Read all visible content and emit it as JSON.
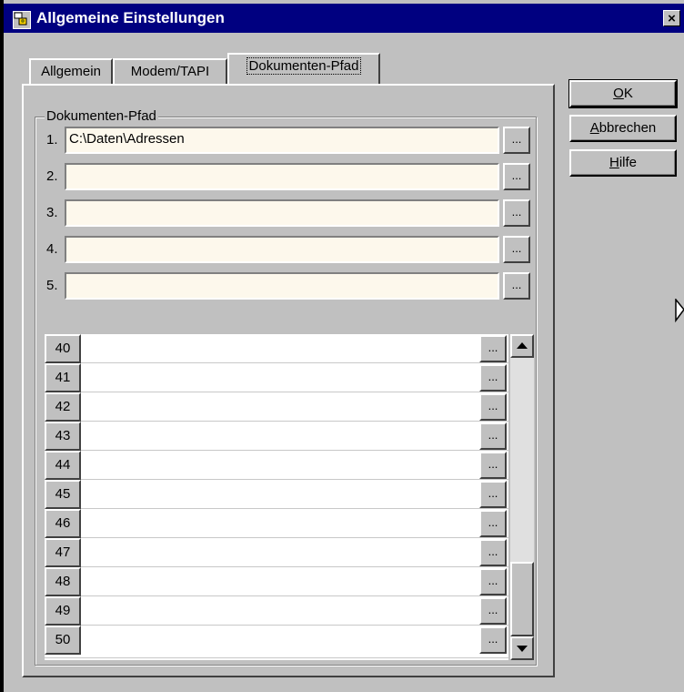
{
  "window": {
    "title": "Allgemeine Einstellungen",
    "close_label": "×"
  },
  "tabs": [
    {
      "label": "Allgemein",
      "active": false
    },
    {
      "label": "Modem/TAPI",
      "active": false
    },
    {
      "label": "Dokumenten-Pfad",
      "active": true
    }
  ],
  "group": {
    "label": "Dokumenten-Pfad"
  },
  "paths": [
    {
      "num": "1.",
      "value": "C:\\Daten\\Adressen",
      "button": "..."
    },
    {
      "num": "2.",
      "value": "",
      "button": "..."
    },
    {
      "num": "3.",
      "value": "",
      "button": "..."
    },
    {
      "num": "4.",
      "value": "",
      "button": "..."
    },
    {
      "num": "5.",
      "value": "",
      "button": "..."
    }
  ],
  "grid_rows": [
    {
      "num": "40",
      "button": "..."
    },
    {
      "num": "41",
      "button": "..."
    },
    {
      "num": "42",
      "button": "..."
    },
    {
      "num": "43",
      "button": "..."
    },
    {
      "num": "44",
      "button": "..."
    },
    {
      "num": "45",
      "button": "..."
    },
    {
      "num": "46",
      "button": "..."
    },
    {
      "num": "47",
      "button": "..."
    },
    {
      "num": "48",
      "button": "..."
    },
    {
      "num": "49",
      "button": "..."
    },
    {
      "num": "50",
      "button": "..."
    }
  ],
  "buttons": {
    "ok": {
      "mnemonic": "O",
      "rest": "K"
    },
    "abbrechen": {
      "mnemonic": "A",
      "rest": "bbrechen"
    },
    "hilfe": {
      "mnemonic": "H",
      "rest": "ilfe"
    }
  },
  "colors": {
    "titlebar": "#000080",
    "face": "#c0c0c0",
    "field_bg": "#fdf8ec"
  }
}
